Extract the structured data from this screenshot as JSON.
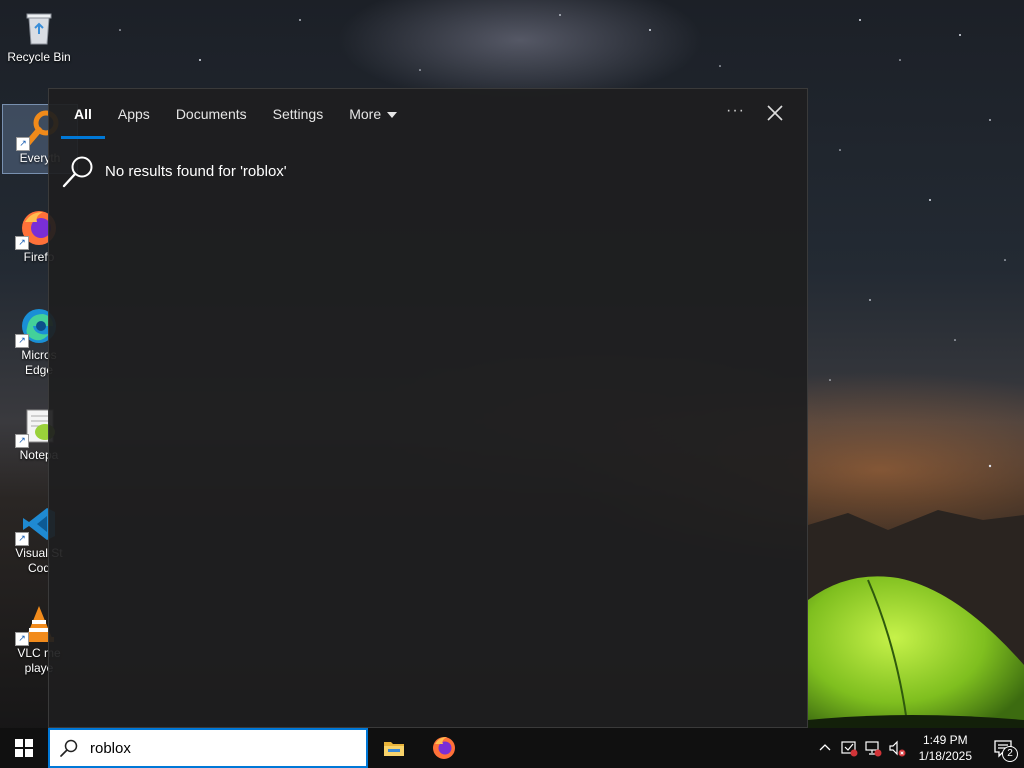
{
  "desktop": {
    "icons": [
      {
        "label": "Recycle Bin",
        "icon": "recycle-bin-icon"
      },
      {
        "label": "Everyth",
        "icon": "everything-search-icon"
      },
      {
        "label": "Firefo",
        "icon": "firefox-icon"
      },
      {
        "label": "Micros\nEdge",
        "icon": "edge-icon"
      },
      {
        "label": "Notepa",
        "icon": "notepad-plus-plus-icon"
      },
      {
        "label": "Visual St\nCod",
        "icon": "vscode-icon"
      },
      {
        "label": "VLC me\nplaye",
        "icon": "vlc-icon"
      }
    ]
  },
  "search_panel": {
    "tabs": [
      {
        "label": "All",
        "active": true
      },
      {
        "label": "Apps"
      },
      {
        "label": "Documents"
      },
      {
        "label": "Settings"
      },
      {
        "label": "More",
        "has_dropdown": true
      }
    ],
    "more_options_label": "···",
    "no_results": "No results found for 'roblox'"
  },
  "taskbar": {
    "search_value": "roblox",
    "pinned_apps": [
      "file-explorer-icon",
      "firefox-icon"
    ],
    "tray_icons": [
      "chevron-up-icon",
      "security-alert-icon",
      "network-disconnected-icon",
      "volume-muted-icon"
    ],
    "time": "1:49 PM",
    "date": "1/18/2025",
    "notification_count": "2"
  },
  "colors": {
    "accent": "#0078d7",
    "panel_bg": "#1e1e1f",
    "taskbar_bg": "#101010"
  }
}
